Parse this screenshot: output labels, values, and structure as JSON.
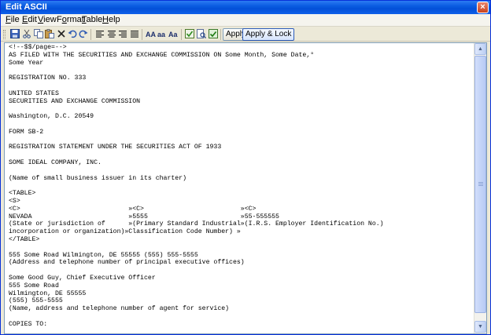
{
  "window": {
    "title": "Edit ASCII",
    "close_glyph": "×"
  },
  "menu": [
    {
      "label": "File",
      "mnemonic": "F",
      "rest": "ile"
    },
    {
      "label": "Edit",
      "mnemonic": "E",
      "rest": "dit"
    },
    {
      "label": "View",
      "mnemonic": "V",
      "rest": "iew"
    },
    {
      "label": "Format",
      "mnemonic": "o",
      "pre": "F",
      "rest": "rmat"
    },
    {
      "label": "Table",
      "mnemonic": "T",
      "rest": "able"
    },
    {
      "label": "Help",
      "mnemonic": "H",
      "rest": "elp"
    }
  ],
  "toolbar": {
    "font_large": "AA",
    "font_small": "aa",
    "font_mixed": "Aa",
    "apply_label": "Apply",
    "apply_lock_label": "Apply & Lock",
    "icons": [
      "save-icon",
      "cut-icon",
      "copy-icon",
      "paste-icon",
      "delete-icon",
      "undo-icon",
      "redo-icon",
      "align-left-icon",
      "align-center-icon",
      "align-right-icon",
      "justify-icon",
      "check-icon",
      "preview-icon",
      "validate-icon"
    ]
  },
  "document": {
    "lines": [
      "<!--$$/page=-->",
      "AS FILED WITH THE SECURITIES AND EXCHANGE COMMISSION ON Some Month, Some Date,°",
      "Some Year",
      "",
      "REGISTRATION NO. 333",
      "",
      "UNITED STATES",
      "SECURITIES AND EXCHANGE COMMISSION",
      "",
      "Washington, D.C. 20549",
      "",
      "FORM SB-2",
      "",
      "REGISTRATION STATEMENT UNDER THE SECURITIES ACT OF 1933",
      "",
      "SOME IDEAL COMPANY, INC.",
      "",
      "(Name of small business issuer in its charter)",
      "",
      "<TABLE>",
      "<S>",
      "<C>                            »<C>                         »<C>",
      "NEVADA                         »5555                        »55-555555",
      "(State or jurisdiction of      »(Primary Standard Industrial»(I.R.S. Employer Identification No.)",
      "incorporation or organization)»Classification Code Number) »",
      "</TABLE>",
      "",
      "555 Some Road Wilmington, DE 55555 (555) 555-5555",
      "(Address and telephone number of principal executive offices)",
      "",
      "Some Good Guy, Chief Executive Officer",
      "555 Some Road",
      "Wilmington, DE 55555",
      "(555) 555-5555",
      "(Name, address and telephone number of agent for service)",
      "",
      "COPIES TO:",
      ""
    ]
  },
  "scrollbar": {
    "up_glyph": "▲",
    "down_glyph": "▼",
    "position_fraction": 0.0
  }
}
